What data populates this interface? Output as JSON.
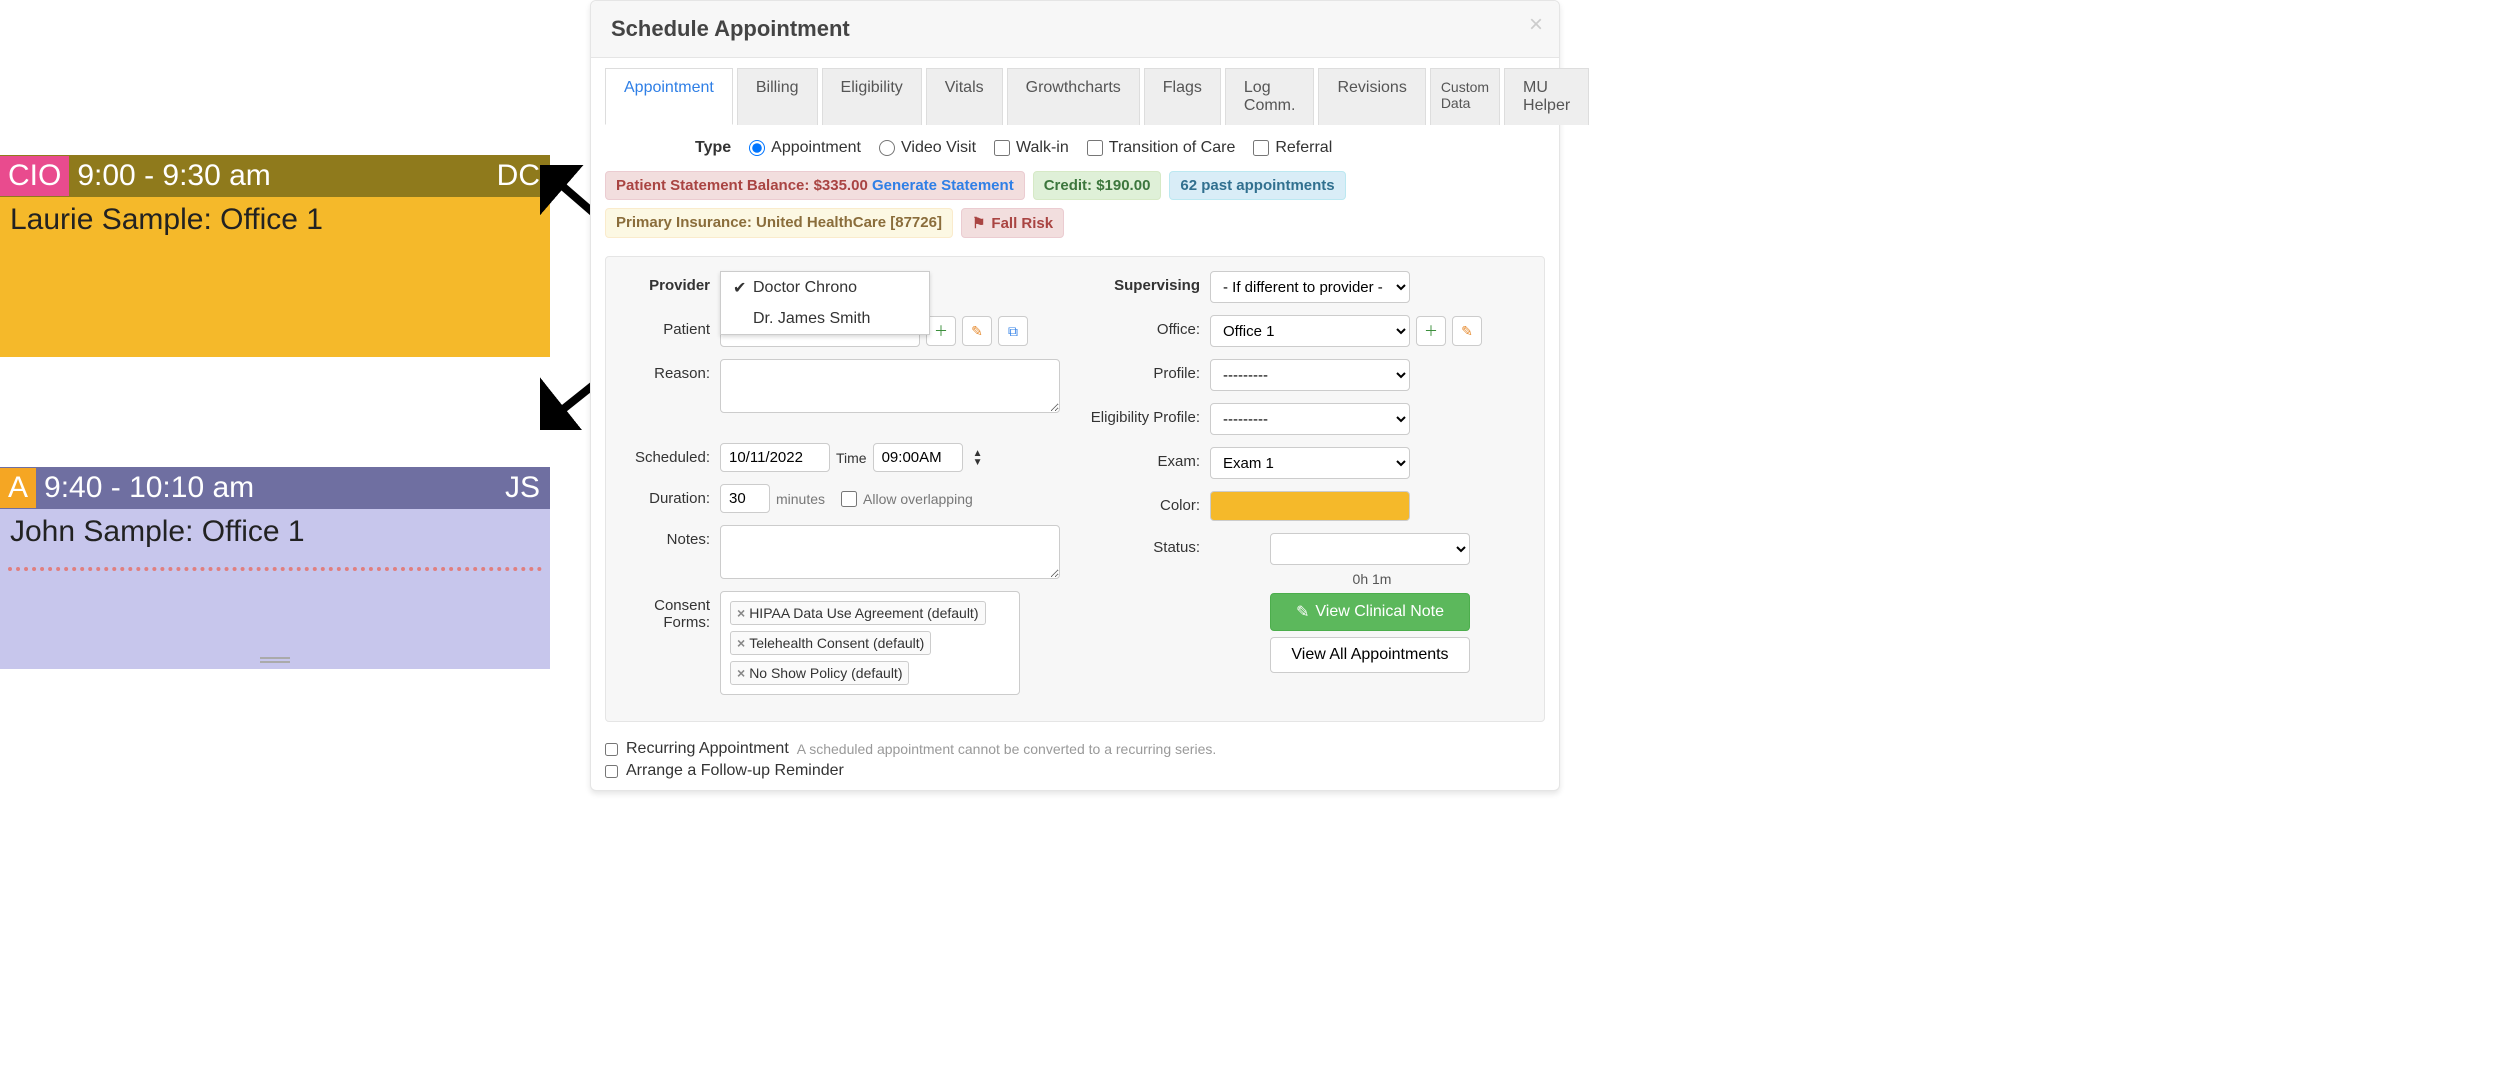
{
  "calendar": {
    "block1": {
      "badge": "CIO",
      "time": "9:00 - 9:30 am",
      "initials": "DC",
      "body": "Laurie Sample: Office 1"
    },
    "block2": {
      "badge": "A",
      "time": "9:40 - 10:10 am",
      "initials": "JS",
      "body": "John Sample: Office 1"
    }
  },
  "modal": {
    "title": "Schedule Appointment",
    "tabs": [
      "Appointment",
      "Billing",
      "Eligibility",
      "Vitals",
      "Growthcharts",
      "Flags",
      "Log Comm.",
      "Revisions",
      "Custom Data",
      "MU Helper"
    ],
    "type": {
      "label": "Type",
      "appointment": "Appointment",
      "video": "Video Visit",
      "walkin": "Walk-in",
      "toc": "Transition of Care",
      "referral": "Referral"
    },
    "badges": {
      "stmt_label": "Patient Statement Balance: ",
      "stmt_amount": "$335.00",
      "gen_stmt": "Generate Statement",
      "credit": "Credit: $190.00",
      "past": "62 past appointments",
      "ins": "Primary Insurance: United HealthCare [87726]",
      "flag": "Fall Risk"
    },
    "labels": {
      "provider": "Provider",
      "patient": "Patient",
      "reason": "Reason:",
      "scheduled": "Scheduled:",
      "time": "Time",
      "duration": "Duration:",
      "minutes": "minutes",
      "allow_overlap": "Allow overlapping",
      "notes": "Notes:",
      "consent": "Consent Forms:",
      "supervising": "Supervising",
      "office": "Office:",
      "profile": "Profile:",
      "elig": "Eligibility Profile:",
      "exam": "Exam:",
      "color": "Color:",
      "status": "Status:"
    },
    "provider_options": [
      "Doctor Chrono",
      "Dr. James Smith"
    ],
    "values": {
      "date": "10/11/2022",
      "time": "09:00AM",
      "duration": "30",
      "supervising": "- If different to provider -",
      "office": "Office 1",
      "profile": "---------",
      "elig": "---------",
      "exam": "Exam 1",
      "status": "",
      "status_time": "0h 1m"
    },
    "consent": [
      "HIPAA Data Use Agreement (default)",
      "Telehealth Consent (default)",
      "No Show Policy (default)"
    ],
    "actions": {
      "clinical": "View Clinical Note",
      "view_all": "View All Appointments"
    },
    "bottom": {
      "recurring": "Recurring Appointment",
      "recurring_hint": "A scheduled appointment cannot be converted to a recurring series.",
      "followup": "Arrange a Follow-up Reminder"
    },
    "color_hex": "#f5b92a"
  }
}
